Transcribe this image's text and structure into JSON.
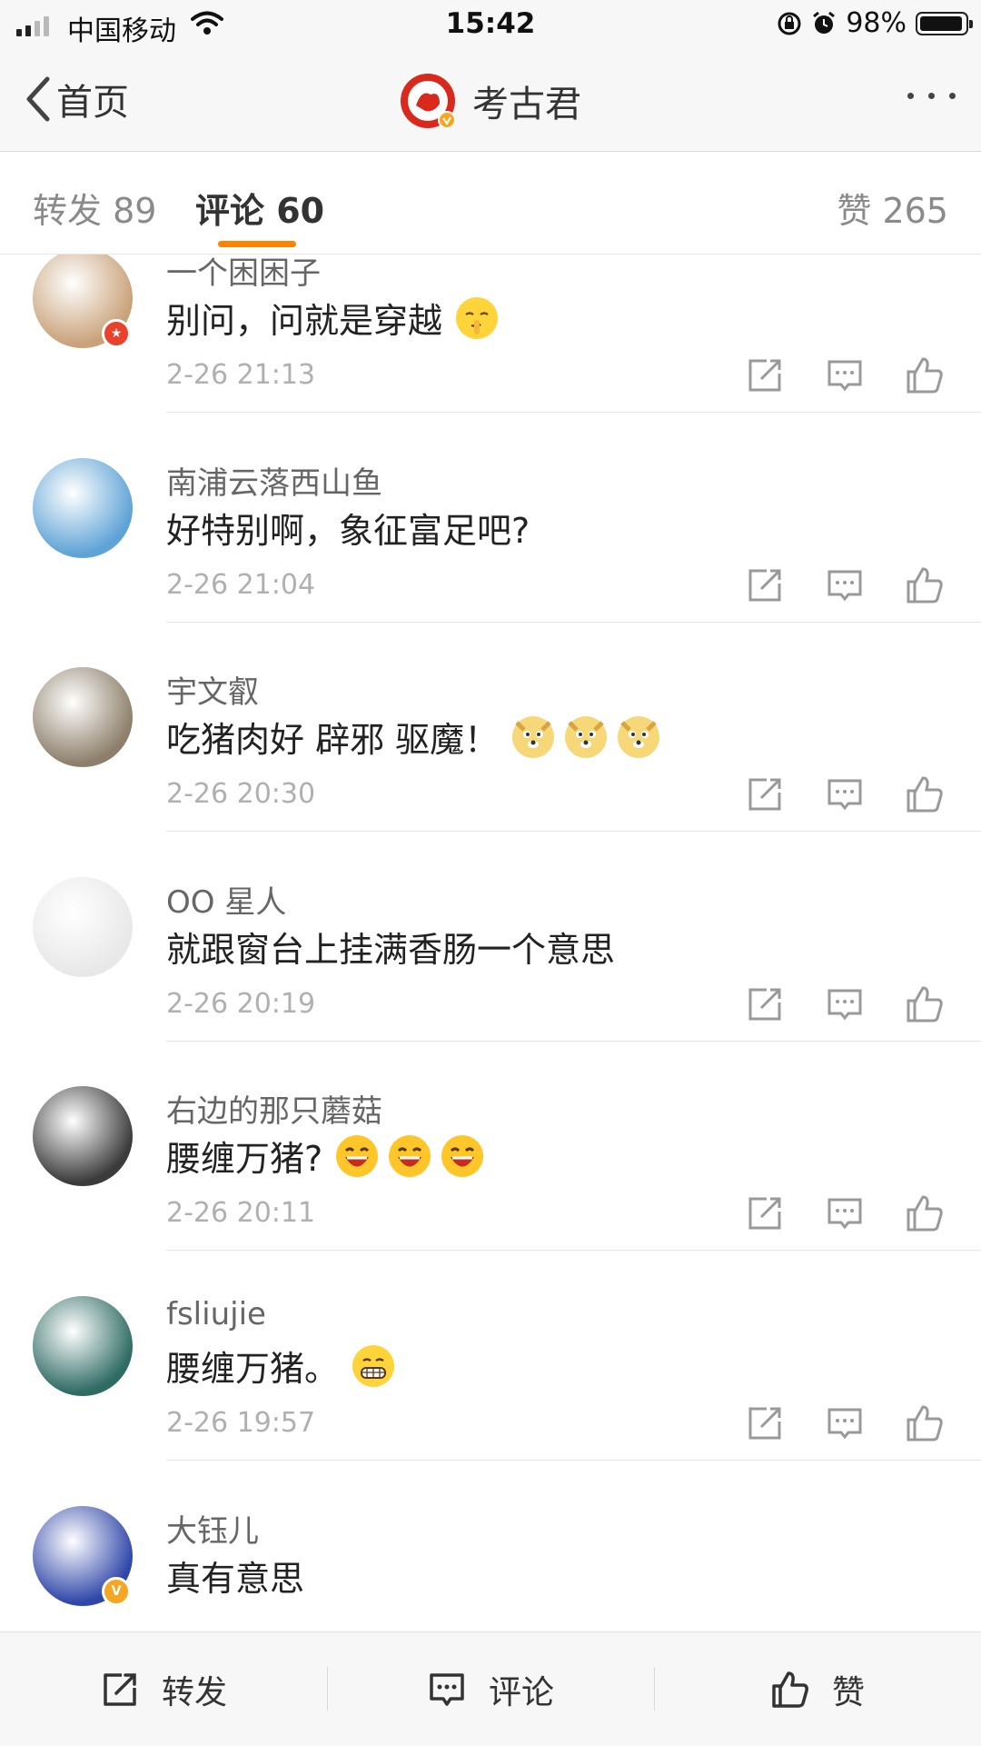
{
  "status_bar": {
    "carrier": "中国移动",
    "time": "15:42",
    "battery": "98%"
  },
  "nav": {
    "back_label": "首页",
    "title": "考古君",
    "more": "更多"
  },
  "tabs": {
    "repost": "转发 89",
    "comments": "评论 60",
    "likes": "赞 265"
  },
  "comments": [
    {
      "user": "一个困困子",
      "text": "别问，问就是穿越",
      "emojis": [
        "shush-emoji"
      ],
      "time": "2-26 21:13",
      "avatar_color": "#c9a27a",
      "badge": "red-star"
    },
    {
      "user": "南浦云落西山鱼",
      "text": "好特别啊，象征富足吧?",
      "emojis": [],
      "time": "2-26 21:04",
      "avatar_color": "#5fa3d6"
    },
    {
      "user": "宇文叡",
      "text": "吃猪肉好 辟邪 驱魔！",
      "emojis": [
        "doge-emoji",
        "doge-emoji",
        "doge-emoji"
      ],
      "time": "2-26 20:30",
      "avatar_color": "#8d7f6b"
    },
    {
      "user": "OO 星人",
      "text": "就跟窗台上挂满香肠一个意思",
      "emojis": [],
      "time": "2-26 20:19",
      "avatar_color": "#e8e8e8"
    },
    {
      "user": "右边的那只蘑菇",
      "text": "腰缠万猪?",
      "emojis": [
        "laugh-emoji",
        "laugh-emoji",
        "laugh-emoji"
      ],
      "time": "2-26 20:11",
      "avatar_color": "#3b3b3b"
    },
    {
      "user": "fsliujie",
      "text": "腰缠万猪。",
      "emojis": [
        "grin-emoji"
      ],
      "time": "2-26 19:57",
      "avatar_color": "#2f6b63"
    },
    {
      "user": "大钰儿",
      "text": "真有意思",
      "emojis": [],
      "time": "",
      "avatar_color": "#3047a8",
      "badge": "gold-v"
    }
  ],
  "toolbar": {
    "repost": "转发",
    "comment": "评论",
    "like": "赞"
  },
  "colors": {
    "accent": "#ff8200",
    "verified": "#f5a623",
    "text": "#333333"
  }
}
